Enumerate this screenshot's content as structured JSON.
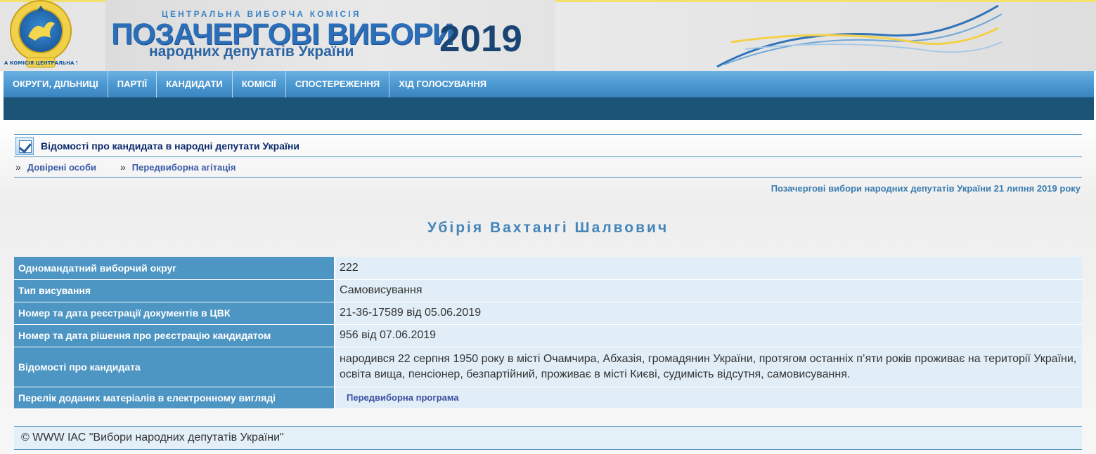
{
  "banner": {
    "commission": "ЦЕНТРАЛЬНА ВИБОРЧА КОМІСІЯ",
    "title": "ПОЗАЧЕРГОВІ ВИБОРИ",
    "subtitle": "народних депутатів України",
    "year": "2019",
    "emblem_icon": "cvk-emblem-icon",
    "emblem_text": "ВИБОРЧА КОМІСІЯ ЦЕНТРАЛЬНА УКРАЇНА"
  },
  "nav": {
    "items": [
      {
        "label": "ОКРУГИ, ДІЛЬНИЦІ"
      },
      {
        "label": "ПАРТІЇ"
      },
      {
        "label": "КАНДИДАТИ"
      },
      {
        "label": "КОМІСІЇ"
      },
      {
        "label": "СПОСТЕРЕЖЕННЯ"
      },
      {
        "label": "ХІД ГОЛОСУВАННЯ"
      }
    ]
  },
  "section": {
    "icon": "checkbox-icon",
    "title": "Відомості про кандидата в народні депутати України"
  },
  "sublinks": [
    {
      "bullet": "»",
      "label": "Довірені особи"
    },
    {
      "bullet": "»",
      "label": "Передвиборна агітація"
    }
  ],
  "election_title": "Позачергові вибори народних депутатів України 21 липня 2019 року",
  "candidate": {
    "name": "Убірія Вахтангі Шалвович"
  },
  "table": {
    "rows": [
      {
        "label": "Одномандатний виборчий округ",
        "value": "222"
      },
      {
        "label": "Тип висування",
        "value": "Самовисування"
      },
      {
        "label": "Номер та дата реєстрації документів в ЦВК",
        "value": "21-36-17589 від 05.06.2019"
      },
      {
        "label": "Номер та дата рішення про реєстрацію кандидатом",
        "value": "956 від 07.06.2019"
      },
      {
        "label": "Відомості про кандидата",
        "value": "народився 22 серпня 1950 року в місті Очамчира, Абхазія, громадянин України, протягом останніх п’яти років проживає на території України, освіта вища, пенсіонер, безпартійний, проживає в місті Києві, судимість відсутня, самовисування."
      },
      {
        "label": "Перелік доданих матеріалів в електронному вигляді",
        "value": "Передвиборна програма"
      }
    ]
  },
  "footer": {
    "text": "© WWW ІАС \"Вибори народних депутатів України\""
  },
  "colors": {
    "nav_blue": "#4f9bd3",
    "nav_dark": "#1c5478",
    "label_blue": "#4d95c3",
    "value_bg": "#e1eef7",
    "link": "#3b5aa8"
  }
}
